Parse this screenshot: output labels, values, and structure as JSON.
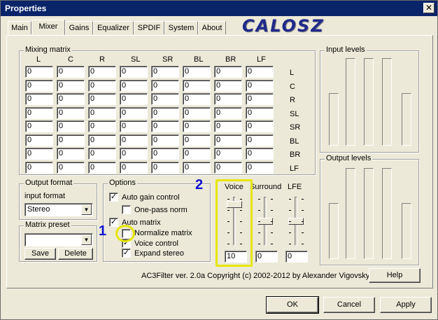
{
  "window": {
    "title": "Properties",
    "close_glyph": "✕"
  },
  "tabs": [
    {
      "label": "Main"
    },
    {
      "label": "Mixer"
    },
    {
      "label": "Gains"
    },
    {
      "label": "Equalizer"
    },
    {
      "label": "SPDIF"
    },
    {
      "label": "System"
    },
    {
      "label": "About"
    }
  ],
  "active_tab": "Mixer",
  "logo": "CALOSZ",
  "mixing_matrix": {
    "title": "Mixing matrix",
    "col_headers": [
      "L",
      "C",
      "R",
      "SL",
      "SR",
      "BL",
      "BR",
      "LF"
    ],
    "row_headers": [
      "L",
      "C",
      "R",
      "SL",
      "SR",
      "BL",
      "BR",
      "LF"
    ],
    "cell_value": "0"
  },
  "input_levels": {
    "title": "Input levels"
  },
  "output_levels": {
    "title": "Output levels"
  },
  "output_format": {
    "title": "Output format",
    "input_format_label": "input format",
    "selected": "Stereo"
  },
  "matrix_preset": {
    "title": "Matrix preset",
    "selected": "",
    "save_label": "Save",
    "delete_label": "Delete"
  },
  "options": {
    "title": "Options",
    "items": [
      {
        "label": "Auto gain control",
        "checked": true
      },
      {
        "label": "One-pass norm",
        "checked": false
      },
      {
        "label": "Auto matrix",
        "checked": true
      },
      {
        "label": "Normalize matrix",
        "checked": false
      },
      {
        "label": "Voice control",
        "checked": true
      },
      {
        "label": "Expand stereo",
        "checked": true
      }
    ]
  },
  "sliders": {
    "voice": {
      "label": "Voice",
      "value": "10",
      "level": 0.15
    },
    "surround": {
      "label": "Surround",
      "value": "0",
      "level": 0.5
    },
    "lfe": {
      "label": "LFE",
      "value": "0",
      "level": 0.5
    }
  },
  "copyright": "AC3Filter ver. 2.0a Copyright (c) 2002-2012 by Alexander Vigovsky",
  "buttons": {
    "help": "Help",
    "ok": "OK",
    "cancel": "Cancel",
    "apply": "Apply"
  },
  "annotations": {
    "one": "1",
    "two": "2"
  },
  "colors": {
    "highlight": "#e6e600",
    "annotation": "#1010d0",
    "titlebar": "#0a246a"
  }
}
